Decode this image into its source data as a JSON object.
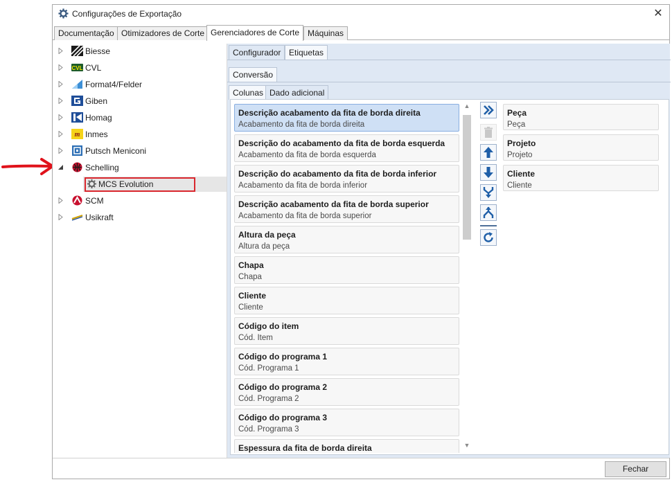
{
  "window": {
    "title": "Configurações de Exportação",
    "title_icon": "gear-icon",
    "close_glyph": "✕"
  },
  "top_tabs": [
    "Documentação",
    "Otimizadores de Corte",
    "Gerenciadores de Corte",
    "Máquinas"
  ],
  "top_tabs_active": "Gerenciadores de Corte",
  "tree": {
    "items": [
      {
        "label": "Biesse",
        "icon": "biesse-logo-icon"
      },
      {
        "label": "CVL",
        "icon": "cvl-logo-icon"
      },
      {
        "label": "Format4/Felder",
        "icon": "format4-logo-icon"
      },
      {
        "label": "Giben",
        "icon": "giben-logo-icon"
      },
      {
        "label": "Homag",
        "icon": "homag-logo-icon"
      },
      {
        "label": "Inmes",
        "icon": "inmes-logo-icon"
      },
      {
        "label": "Putsch Meniconi",
        "icon": "putsch-logo-icon"
      },
      {
        "label": "Schelling",
        "icon": "schelling-logo-icon",
        "expanded": true
      },
      {
        "label": "MCS Evolution",
        "icon": "gear-icon",
        "child": true,
        "selected": true
      },
      {
        "label": "SCM",
        "icon": "scm-logo-icon"
      },
      {
        "label": "Usikraft",
        "icon": "usikraft-logo-icon"
      }
    ]
  },
  "panel_tabs": [
    "Configurador",
    "Etiquetas"
  ],
  "panel_tabs_active": "Etiquetas",
  "sub_tabs": [
    "Conversão"
  ],
  "sub_tabs_active": "Conversão",
  "column_tabs": [
    "Colunas",
    "Dado adicional"
  ],
  "column_tabs_active": "Colunas",
  "available_columns": [
    {
      "title": "Descrição acabamento da fita de borda direita",
      "subtitle": "Acabamento da fita de borda direita",
      "selected": true
    },
    {
      "title": "Descrição do acabamento da fita de borda esquerda",
      "subtitle": "Acabamento da fita de borda esquerda"
    },
    {
      "title": "Descrição do acabamento da fita de borda inferior",
      "subtitle": "Acabamento da fita de borda inferior"
    },
    {
      "title": "Descrição acabamento da fita de borda superior",
      "subtitle": "Acabamento da fita de borda superior"
    },
    {
      "title": "Altura da peça",
      "subtitle": "Altura da peça"
    },
    {
      "title": "Chapa",
      "subtitle": "Chapa"
    },
    {
      "title": "Cliente",
      "subtitle": "Cliente"
    },
    {
      "title": "Código do item",
      "subtitle": "Cód. Item"
    },
    {
      "title": "Código do programa 1",
      "subtitle": "Cód. Programa 1"
    },
    {
      "title": "Código do programa 2",
      "subtitle": "Cód. Programa 2"
    },
    {
      "title": "Código do programa 3",
      "subtitle": "Cód. Programa 3"
    },
    {
      "title": "Espessura da fita de borda direita",
      "subtitle": ""
    }
  ],
  "selected_columns": [
    {
      "title": "Peça",
      "subtitle": "Peça"
    },
    {
      "title": "Projeto",
      "subtitle": "Projeto"
    },
    {
      "title": "Cliente",
      "subtitle": "Cliente"
    }
  ],
  "toolbar_buttons": [
    {
      "name": "add-all-button",
      "icon": "double-chevron-right-icon",
      "enabled": true
    },
    {
      "name": "delete-button",
      "icon": "trash-icon",
      "enabled": false
    },
    {
      "name": "move-up-button",
      "icon": "arrow-up-icon",
      "enabled": true
    },
    {
      "name": "move-down-button",
      "icon": "arrow-down-icon",
      "enabled": true
    },
    {
      "name": "merge-button",
      "icon": "merge-icon",
      "enabled": true
    },
    {
      "name": "split-button",
      "icon": "split-icon",
      "enabled": true
    },
    {
      "name": "refresh-button",
      "icon": "refresh-icon",
      "enabled": true
    }
  ],
  "footer": {
    "close_label": "Fechar"
  },
  "colors": {
    "accent": "#1f5fa8",
    "annotation_red": "#e0121b",
    "panel_bg": "#dfe8f4",
    "selection_bg": "#cfe0f5"
  }
}
